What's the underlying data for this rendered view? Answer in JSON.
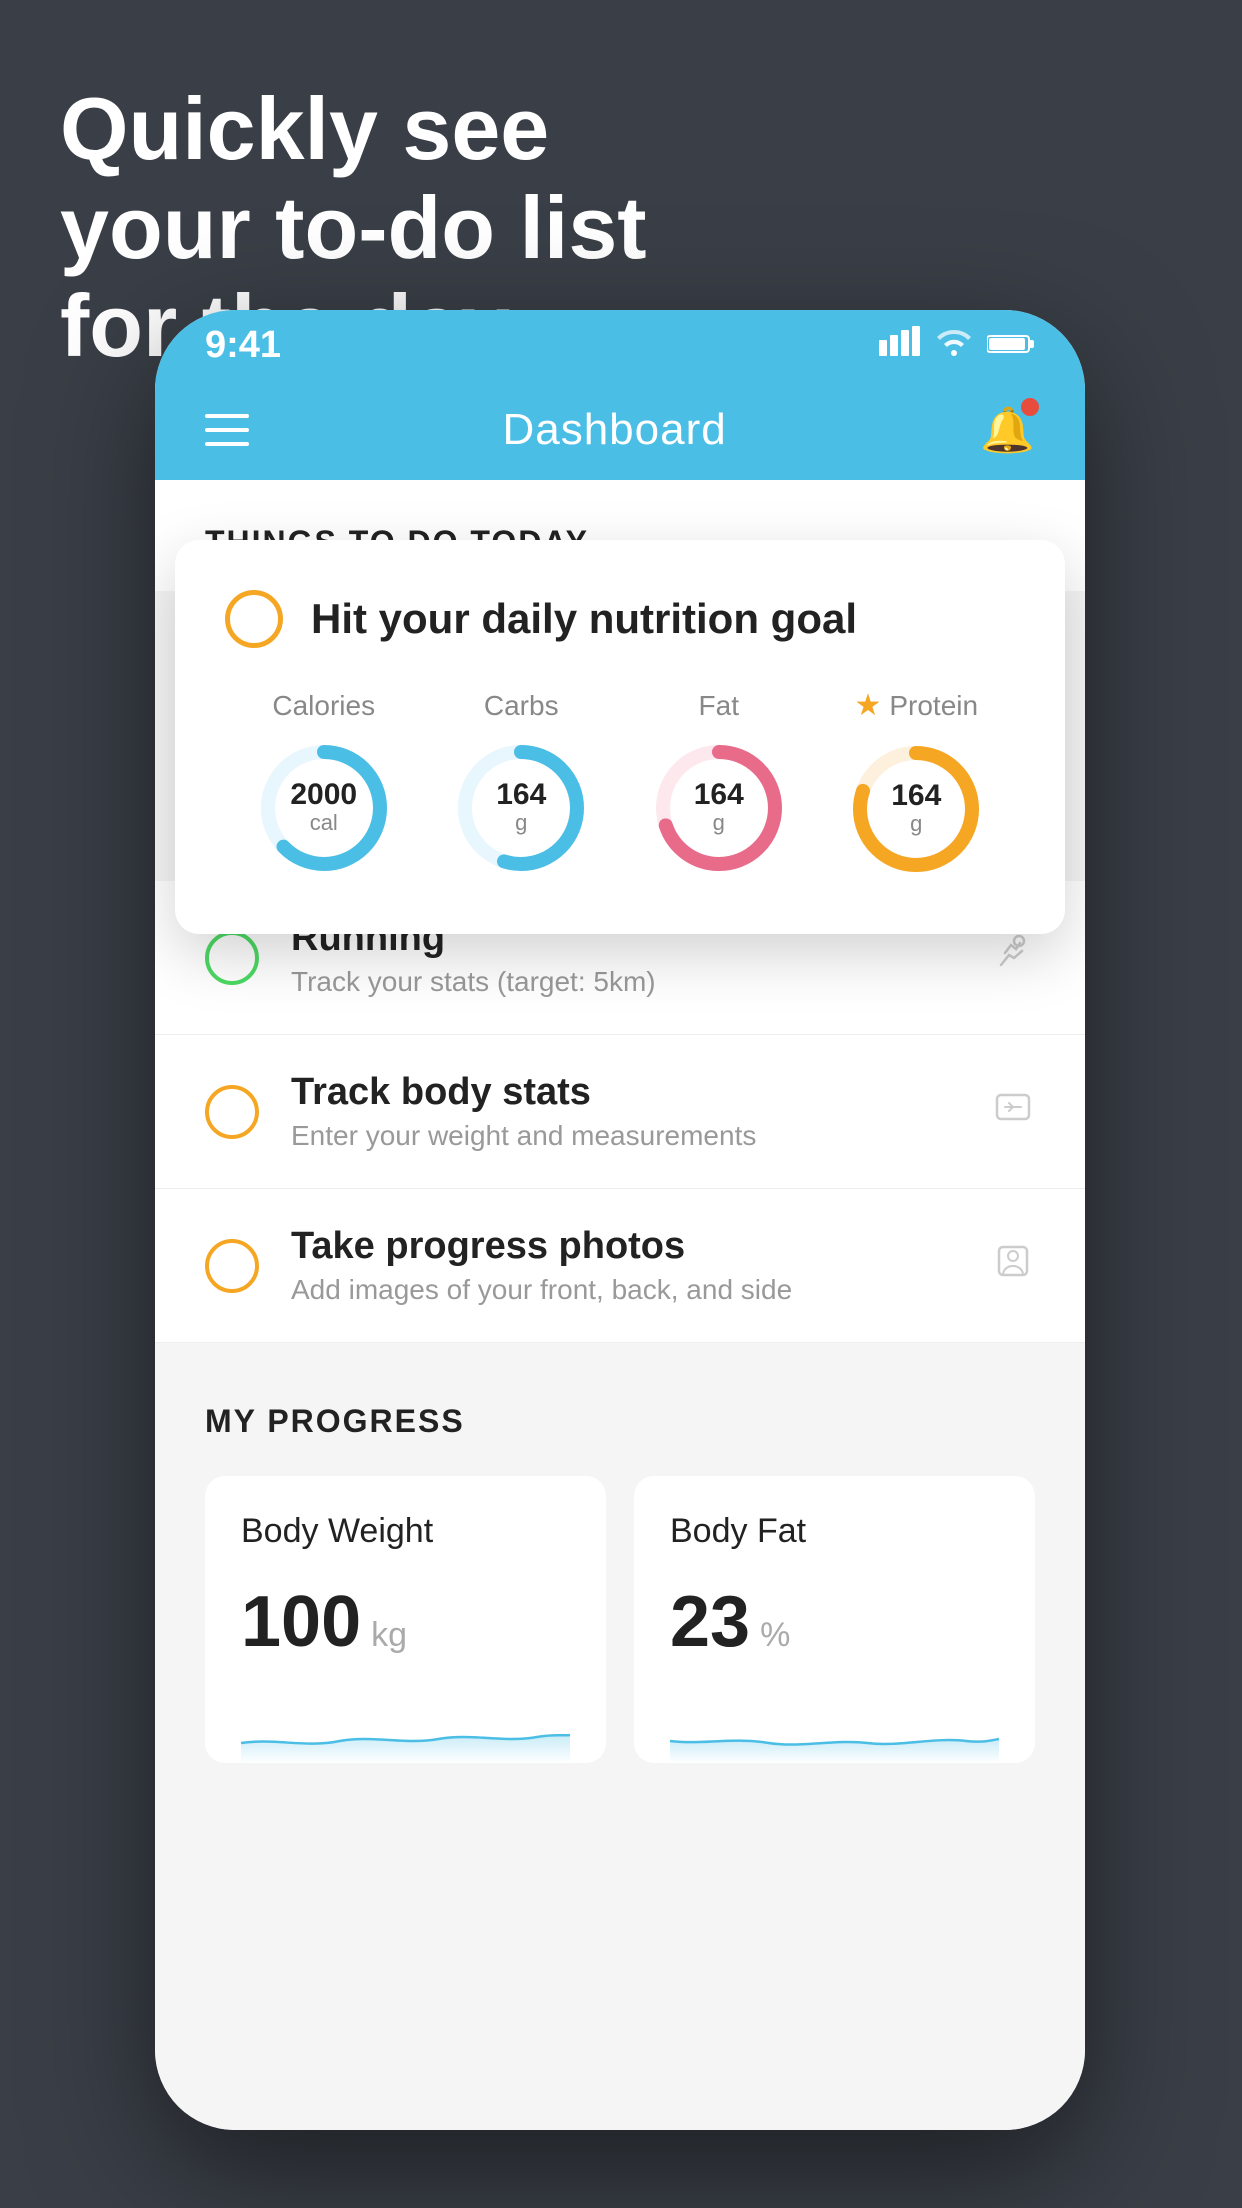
{
  "headline": {
    "line1": "Quickly see",
    "line2": "your to-do list",
    "line3": "for the day."
  },
  "status_bar": {
    "time": "9:41",
    "signal_icon": "▋▋▋▋",
    "wifi_icon": "wifi",
    "battery_icon": "battery"
  },
  "nav": {
    "title": "Dashboard"
  },
  "things_section": {
    "title": "THINGS TO DO TODAY"
  },
  "nutrition_card": {
    "title": "Hit your daily nutrition goal",
    "stats": [
      {
        "label": "Calories",
        "value": "2000",
        "unit": "cal",
        "color": "#4bbee6",
        "pct": 65,
        "starred": false
      },
      {
        "label": "Carbs",
        "value": "164",
        "unit": "g",
        "color": "#4bbee6",
        "pct": 55,
        "starred": false
      },
      {
        "label": "Fat",
        "value": "164",
        "unit": "g",
        "color": "#e96b8a",
        "pct": 70,
        "starred": false
      },
      {
        "label": "Protein",
        "value": "164",
        "unit": "g",
        "color": "#f5a623",
        "pct": 80,
        "starred": true
      }
    ]
  },
  "todo_items": [
    {
      "name": "Running",
      "sub": "Track your stats (target: 5km)",
      "circle_color": "green",
      "icon": "👟"
    },
    {
      "name": "Track body stats",
      "sub": "Enter your weight and measurements",
      "circle_color": "yellow",
      "icon": "⚖"
    },
    {
      "name": "Take progress photos",
      "sub": "Add images of your front, back, and side",
      "circle_color": "yellow",
      "icon": "👤"
    }
  ],
  "progress": {
    "title": "MY PROGRESS",
    "cards": [
      {
        "title": "Body Weight",
        "value": "100",
        "unit": "kg"
      },
      {
        "title": "Body Fat",
        "value": "23",
        "unit": "%"
      }
    ]
  }
}
